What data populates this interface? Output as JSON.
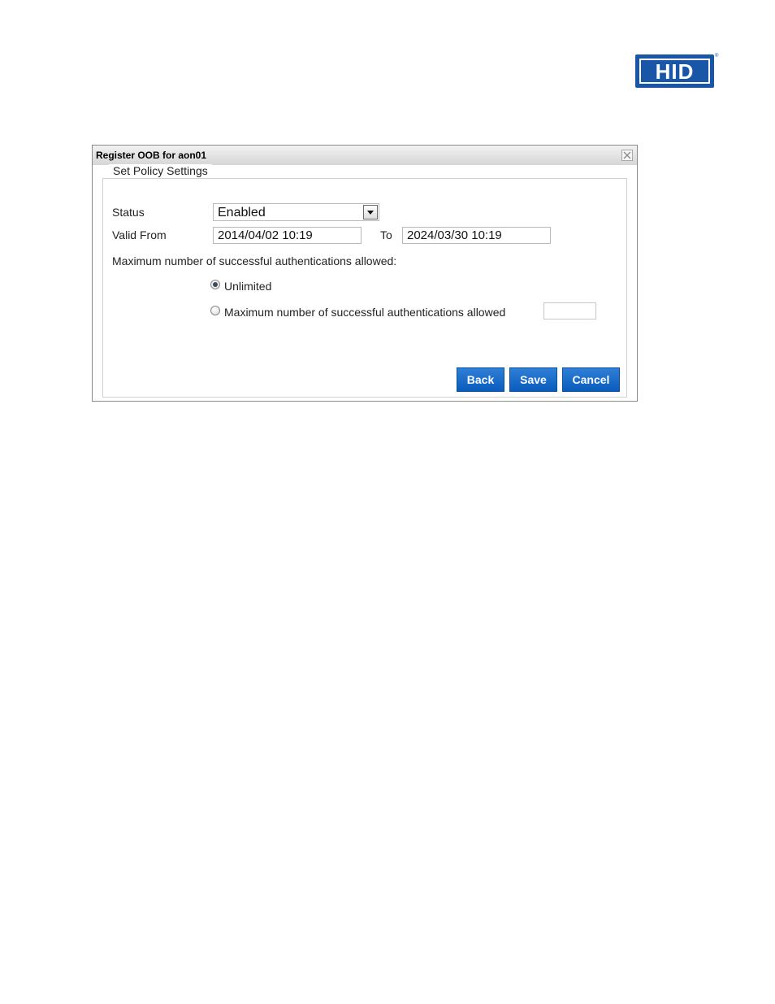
{
  "logo": {
    "text": "HID",
    "registered_mark": "®",
    "color": "#1a56a8"
  },
  "dialog": {
    "title": "Register OOB for aon01",
    "legend": "Set Policy Settings",
    "status": {
      "label": "Status",
      "value": "Enabled"
    },
    "valid": {
      "from_label": "Valid From",
      "from_value": "2014/04/02 10:19",
      "to_label": "To",
      "to_value": "2024/03/30 10:19"
    },
    "max_auth": {
      "heading": "Maximum number of successful authentications allowed:",
      "options": [
        {
          "label": "Unlimited",
          "selected": true
        },
        {
          "label": "Maximum number of successful authentications allowed",
          "selected": false
        }
      ],
      "count_value": ""
    },
    "buttons": {
      "back": "Back",
      "save": "Save",
      "cancel": "Cancel"
    },
    "colors": {
      "button": "#0a5cbd",
      "titlebar": "#d6d6d6"
    }
  }
}
